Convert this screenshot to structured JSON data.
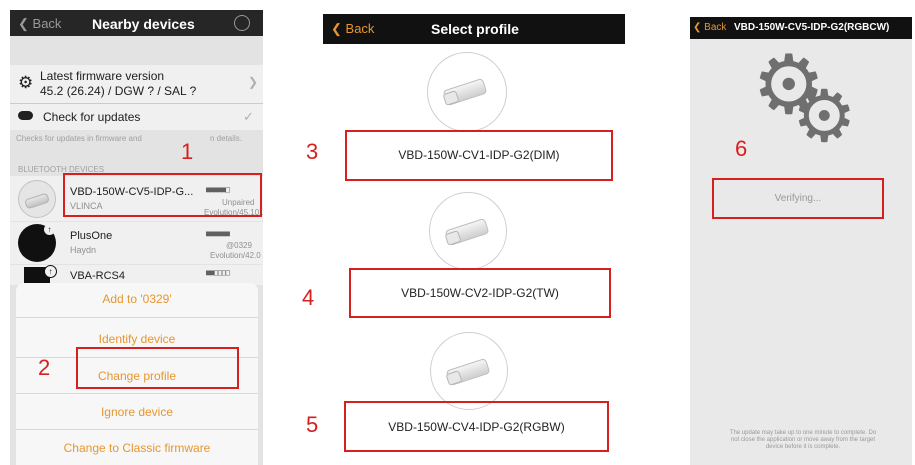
{
  "screen1": {
    "nav_back": "Back",
    "nav_title": "Nearby devices",
    "firmware_label": "Latest firmware version",
    "firmware_value": "45.2 (26.24) / DGW ? / SAL ?",
    "check_updates": "Check for updates",
    "check_note": "Checks for updates in firmware and",
    "check_note_tail": "n details.",
    "section_header": "BLUETOOTH DEVICES",
    "devices": [
      {
        "name": "VBD-150W-CV5-IDP-G...",
        "sub": "VLINCA",
        "signal": "■■■■■□",
        "status": "Unpaired",
        "version": "Evolution/45.101"
      },
      {
        "name": "PlusOne",
        "sub": "Haydn",
        "signal": "■■■■■■",
        "status": "@0329",
        "version": "Evolution/42.0"
      },
      {
        "name": "VBA-RCS4",
        "sub": "",
        "signal": "■■□□□□",
        "status": "",
        "version": ""
      }
    ],
    "sheet": {
      "add": "Add to '0329'",
      "identify": "Identify device",
      "change_profile": "Change profile",
      "ignore": "Ignore device",
      "classic": "Change to Classic firmware"
    },
    "step1": "1",
    "step2": "2"
  },
  "screen2": {
    "nav_back": "Back",
    "nav_title": "Select profile",
    "profiles": [
      {
        "label": "VBD-150W-CV1-IDP-G2(DIM)",
        "step": "3"
      },
      {
        "label": "VBD-150W-CV2-IDP-G2(TW)",
        "step": "4"
      },
      {
        "label": "VBD-150W-CV4-IDP-G2(RGBW)",
        "step": "5"
      }
    ]
  },
  "screen3": {
    "nav_back": "Back",
    "nav_title": "VBD-150W-CV5-IDP-G2(RGBCW)",
    "step": "6",
    "verifying": "Verifying...",
    "note": "The update may take up to one minute to complete. Do not close the application or move away from the target device before it is complete."
  },
  "colors": {
    "accent": "#e7962f",
    "highlight": "#d61f1f",
    "nav": "#111111"
  }
}
